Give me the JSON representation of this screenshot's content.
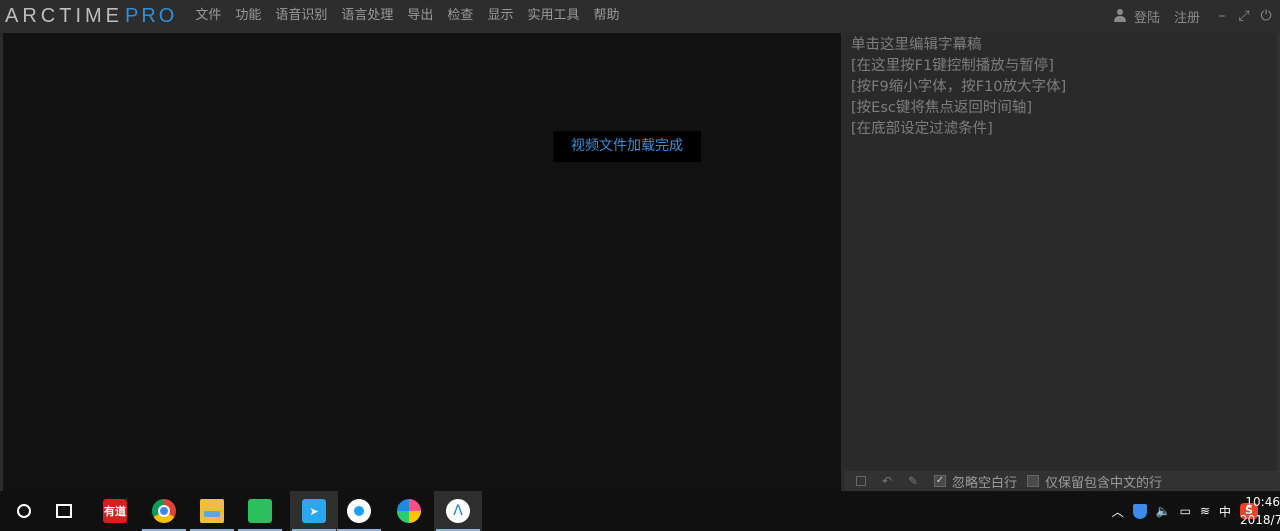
{
  "app": {
    "logo_main": "ARCTIME",
    "logo_accent": "PRO"
  },
  "menu": [
    "文件",
    "功能",
    "语音识别",
    "语言处理",
    "导出",
    "检查",
    "显示",
    "实用工具",
    "帮助"
  ],
  "account": {
    "login": "登陆",
    "register": "注册"
  },
  "window_controls": {
    "minimize": "–",
    "maximize": "⤢",
    "power": "⏻"
  },
  "video": {
    "status_toast": "视频文件加载完成"
  },
  "editor": {
    "lines": [
      "单击这里编辑字幕稿",
      "[在这里按F1键控制播放与暂停]",
      "[按F9缩小字体，按F10放大字体]",
      "[按Esc键将焦点返回时间轴]",
      "[在底部设定过滤条件]"
    ],
    "filter_skip_blank": "忽略空白行",
    "filter_chinese_only": "仅保留包含中文的行"
  },
  "taskbar": {
    "apps": [
      "youdao",
      "chrome",
      "file-explorer",
      "evernote",
      "feishu",
      "qq-browser",
      "petal",
      "arctime"
    ],
    "youdao_label": "有道",
    "tray": {
      "input_lang": "中",
      "sogou": "S"
    },
    "clock_time": "10:46",
    "clock_date": "2018/7"
  }
}
